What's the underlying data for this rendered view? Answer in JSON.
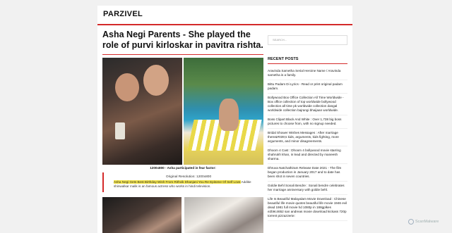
{
  "site": {
    "title": "PARZIVEL"
  },
  "post": {
    "title": "Asha Negi Parents - She played the role of purvi kirloskar in pavitra rishta.",
    "caption": "1200x800 - Asha participated in fear factor:",
    "resolution": "Original Resolution: 1200x800",
    "highlight": "Asha Negi Gets Best Birthday Wish From Rithvik Dhanjani You Re Epitome Of Self Love",
    "para_rest": " Additie shinwalkar malik is an famous actress who works in hindi television."
  },
  "sidebar": {
    "search_placeholder": "SEARCH...",
    "recent_title": "RECENT POSTS",
    "recent": [
      "Aravinda Sametha Serial Heroine Name / Aravinda sametha is a family.",
      "Bittu Padam Di Lyrics - Read or print original padam padam.",
      "Bollywood Box Office Collection All Time Worldwide - Box office collection of top worldwide bollywood collection all time pk worldwide collection dangal worldwide collection bajrangi bhaijaan worldwide.",
      "Boss Clipart Black And White : Over 1,738 big boss pictures to choose from, with no signup needed.",
      "Bridal Shower Wishes Messages : After marriage there&#039;s kids, arguments, kids fighting, more arguments, and minor disagreements.",
      "Dhoom 4 Cast : Dhoom 4 bollywood movie starring shahrukh khan, in lead and directed by maneesh sharma.",
      "Dhruva Natchathiram Release Date 2021 - The film began production in January 2017 and to date has been shot in seven countries.",
      "Goldie Behl Sonali Bendre : Sonali bendre celebrates her marriage anniversary with goldie behl.",
      "Life Is Beautiful Malayalam Movie Download : Chinese beautiful life movie quotes beautiful life movie 1946 evil dead 1981 full movie hd 1080p in 188gplkes e2b9c4652 san andreas movie download kickass 720p torrent pizzazzerie:"
    ]
  },
  "watermark": "ScanMalware",
  "colors": {
    "accent": "#d42a2a",
    "highlight": "#f3e44a"
  }
}
